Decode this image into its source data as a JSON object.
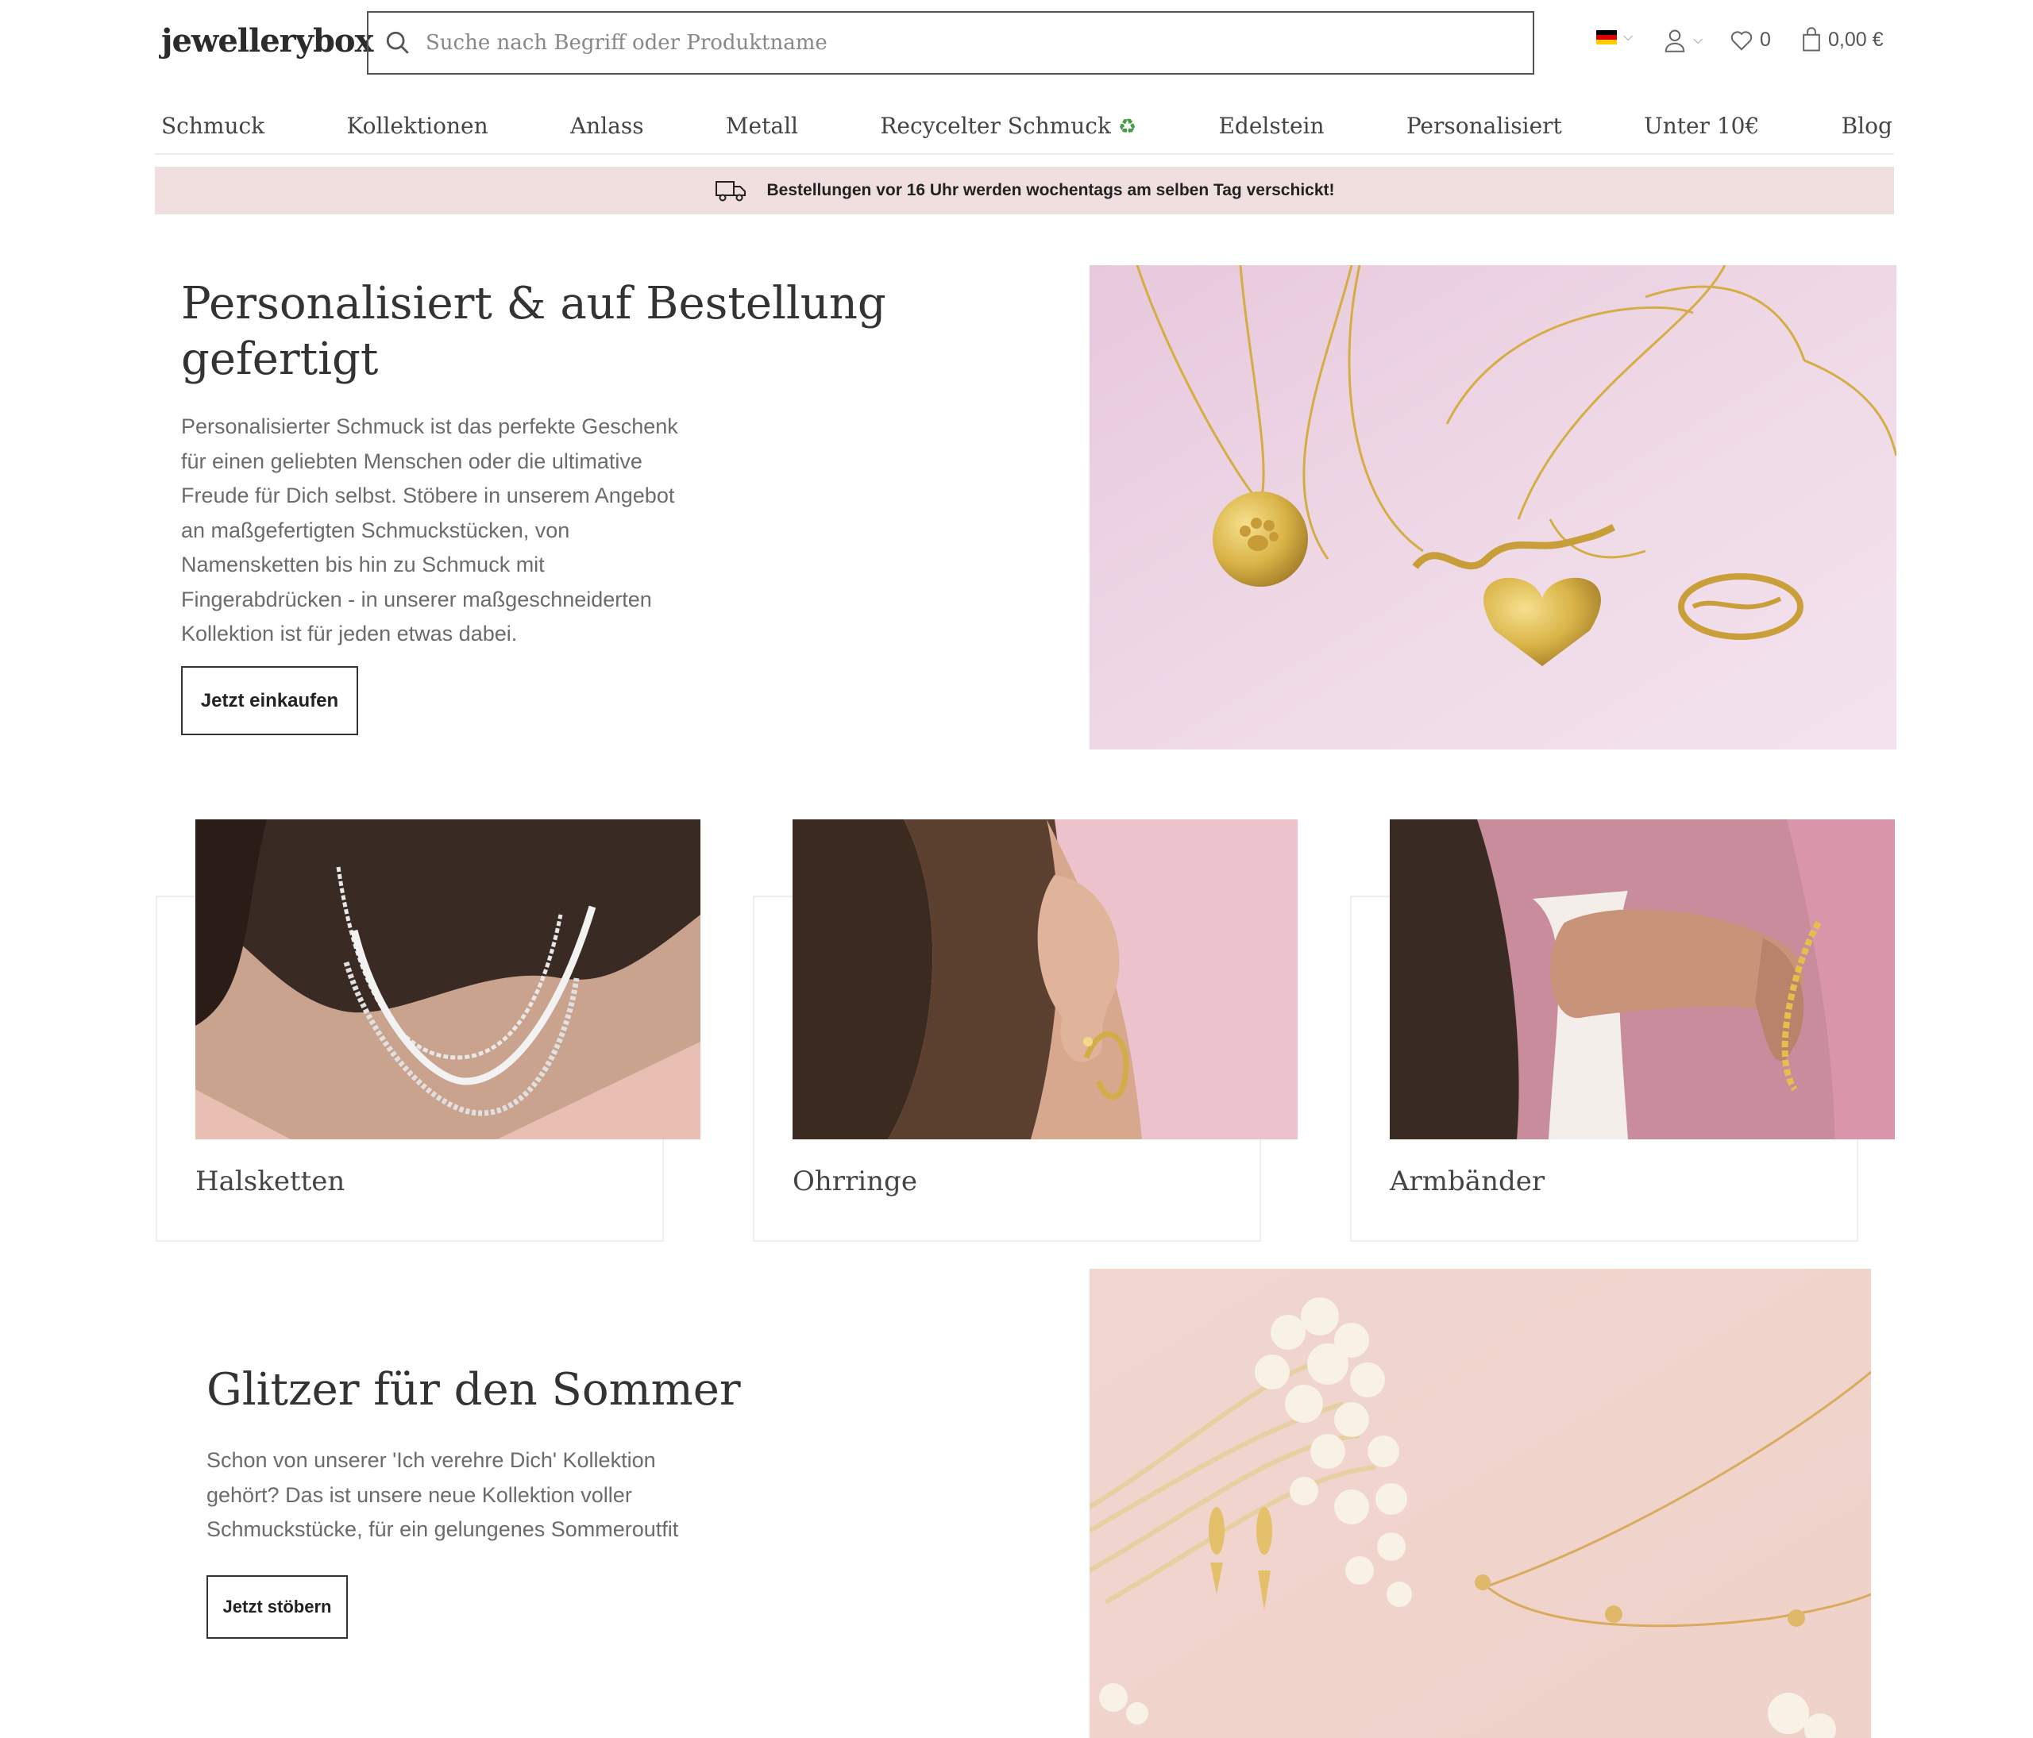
{
  "header": {
    "logo": "jewellerybox",
    "search_placeholder": "Suche nach Begriff oder Produktname",
    "wishlist_count": "0",
    "cart_total": "0,00 €"
  },
  "nav": {
    "items": [
      "Schmuck",
      "Kollektionen",
      "Anlass",
      "Metall",
      "Recycelter Schmuck",
      "Edelstein",
      "Personalisiert",
      "Unter 10€",
      "Blog"
    ],
    "recycle_icon": "♻"
  },
  "banner": {
    "text": "Bestellungen vor 16 Uhr werden wochentags am selben Tag verschickt!"
  },
  "hero": {
    "title": "Personalisiert & auf Bestellung gefertigt",
    "text": "Personalisierter Schmuck ist das perfekte Geschenk für einen geliebten Menschen oder die ultimative Freude für Dich selbst. Stöbere in unserem Angebot an maßgefertigten Schmuckstücken, von Namensketten bis hin zu Schmuck mit Fingerabdrücken - in unserer maßgeschneiderten Kollektion ist für jeden etwas dabei.",
    "button": "Jetzt einkaufen"
  },
  "categories": [
    {
      "label": "Halsketten"
    },
    {
      "label": "Ohrringe"
    },
    {
      "label": "Armbänder"
    }
  ],
  "summer": {
    "title": "Glitzer für den Sommer",
    "text": "Schon von unserer 'Ich verehre Dich' Kollektion gehört? Das ist unsere neue Kollektion voller Schmuckstücke, für ein gelungenes Sommeroutfit",
    "button": "Jetzt stöbern"
  },
  "colors": {
    "banner_bg": "#f1dfe0",
    "text_primary": "#333333",
    "text_muted": "#6b6b6b"
  }
}
